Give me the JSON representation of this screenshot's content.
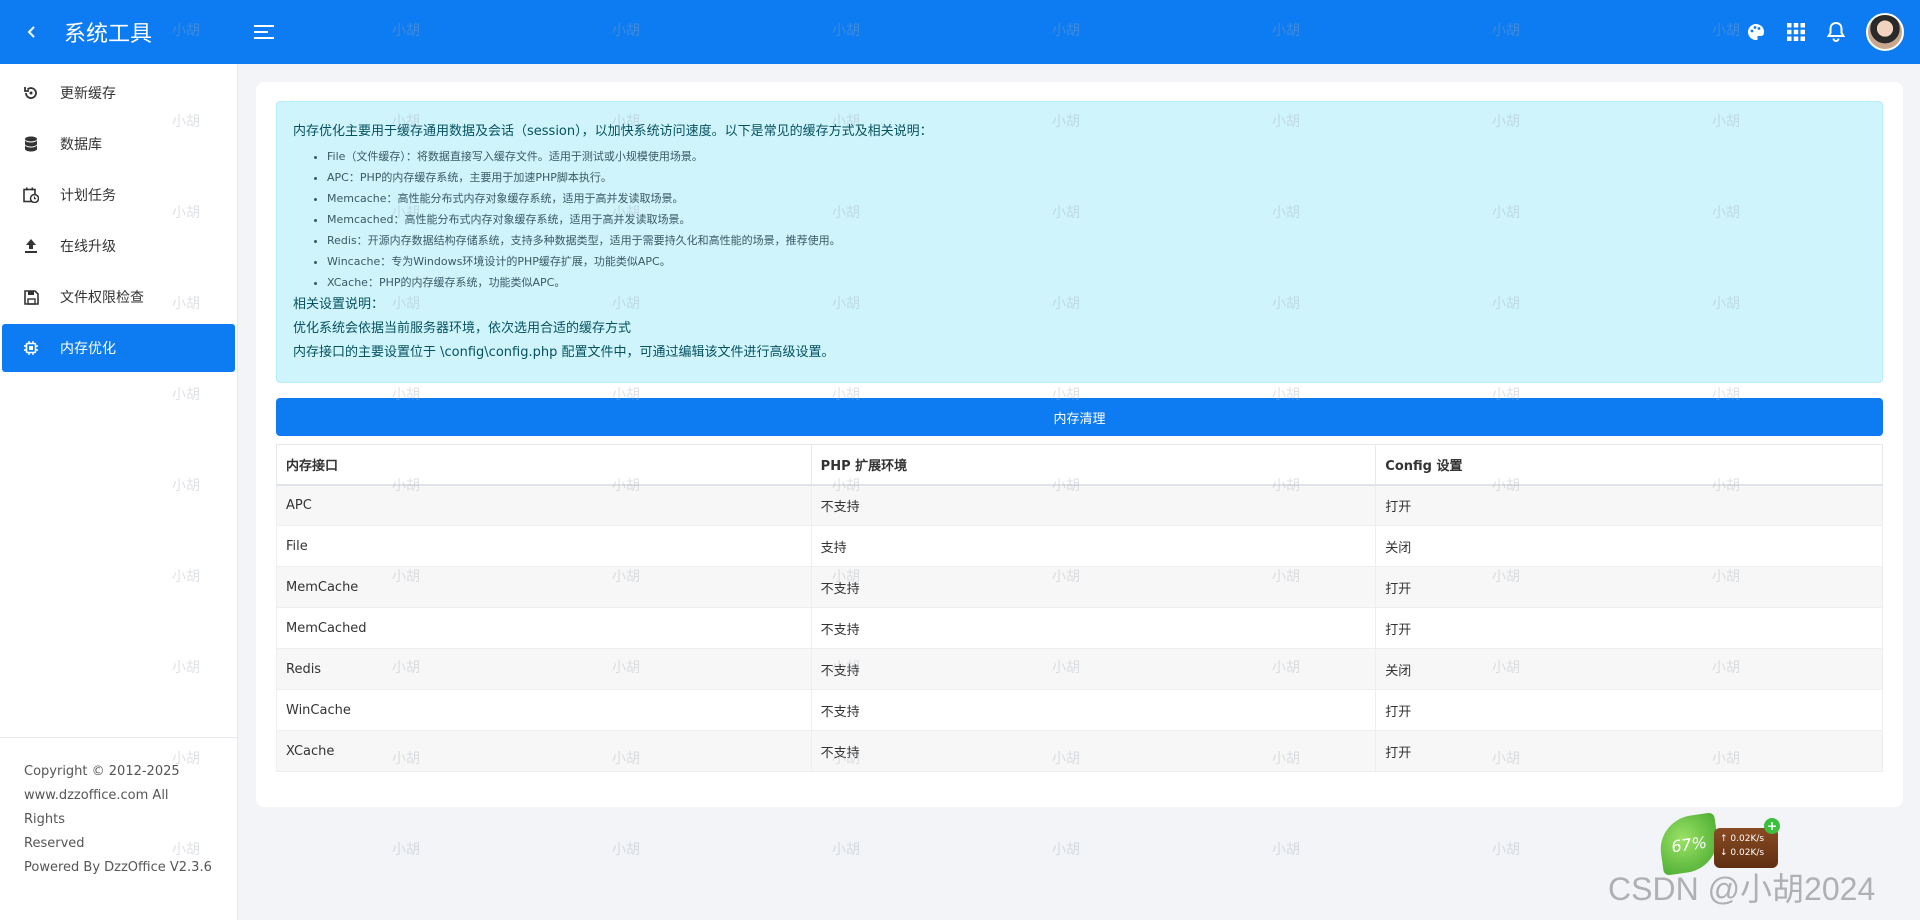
{
  "header": {
    "title": "系统工具",
    "back_icon": "chevron-left-icon",
    "menu_icon": "menu-icon",
    "right_icons": [
      "palette-icon",
      "apps-grid-icon",
      "bell-icon"
    ],
    "brand_color": "#0d7bf2"
  },
  "sidebar": {
    "items": [
      {
        "label": "更新缓存",
        "icon": "refresh-icon",
        "active": false
      },
      {
        "label": "数据库",
        "icon": "database-icon",
        "active": false
      },
      {
        "label": "计划任务",
        "icon": "calendar-clock-icon",
        "active": false
      },
      {
        "label": "在线升级",
        "icon": "upload-icon",
        "active": false
      },
      {
        "label": "文件权限检查",
        "icon": "save-icon",
        "active": false
      },
      {
        "label": "内存优化",
        "icon": "chip-icon",
        "active": true
      }
    ],
    "footer": {
      "line1": "Copyright © 2012-2025",
      "line2": "www.dzzoffice.com All Rights",
      "line3": "Reserved",
      "line4": "Powered By DzzOffice V2.3.6"
    }
  },
  "info": {
    "intro": "内存优化主要用于缓存通用数据及会话（session），以加快系统访问速度。以下是常见的缓存方式及相关说明：",
    "bullets": [
      "File（文件缓存）：将数据直接写入缓存文件。适用于测试或小规模使用场景。",
      "APC：PHP的内存缓存系统，主要用于加速PHP脚本执行。",
      "Memcache：高性能分布式内存对象缓存系统，适用于高并发读取场景。",
      "Memcached：高性能分布式内存对象缓存系统，适用于高并发读取场景。",
      "Redis：开源内存数据结构存储系统，支持多种数据类型，适用于需要持久化和高性能的场景，推荐使用。",
      "Wincache：专为Windows环境设计的PHP缓存扩展，功能类似APC。",
      "XCache：PHP的内存缓存系统，功能类似APC。"
    ],
    "settings_title": "相关设置说明：",
    "settings_line1": "优化系统会依据当前服务器环境，依次选用合适的缓存方式",
    "settings_line2": "内存接口的主要设置位于 \\config\\config.php 配置文件中，可通过编辑该文件进行高级设置。"
  },
  "clear_button": "内存清理",
  "table": {
    "headers": [
      "内存接口",
      "PHP 扩展环境",
      "Config 设置"
    ],
    "rows": [
      {
        "name": "APC",
        "php": "不支持",
        "php_ok": false,
        "config": "打开",
        "config_open": true
      },
      {
        "name": "File",
        "php": "支持",
        "php_ok": true,
        "config": "关闭",
        "config_open": false
      },
      {
        "name": "MemCache",
        "php": "不支持",
        "php_ok": false,
        "config": "打开",
        "config_open": true
      },
      {
        "name": "MemCached",
        "php": "不支持",
        "php_ok": false,
        "config": "打开",
        "config_open": true
      },
      {
        "name": "Redis",
        "php": "不支持",
        "php_ok": false,
        "config": "关闭",
        "config_open": false
      },
      {
        "name": "WinCache",
        "php": "不支持",
        "php_ok": false,
        "config": "打开",
        "config_open": true
      },
      {
        "name": "XCache",
        "php": "不支持",
        "php_ok": false,
        "config": "打开",
        "config_open": true
      }
    ]
  },
  "net_widget": {
    "percent": "67%",
    "up": "0.02K/s",
    "down": "0.02K/s"
  },
  "watermark": "小胡",
  "csdn_watermark": "CSDN @小胡2024"
}
